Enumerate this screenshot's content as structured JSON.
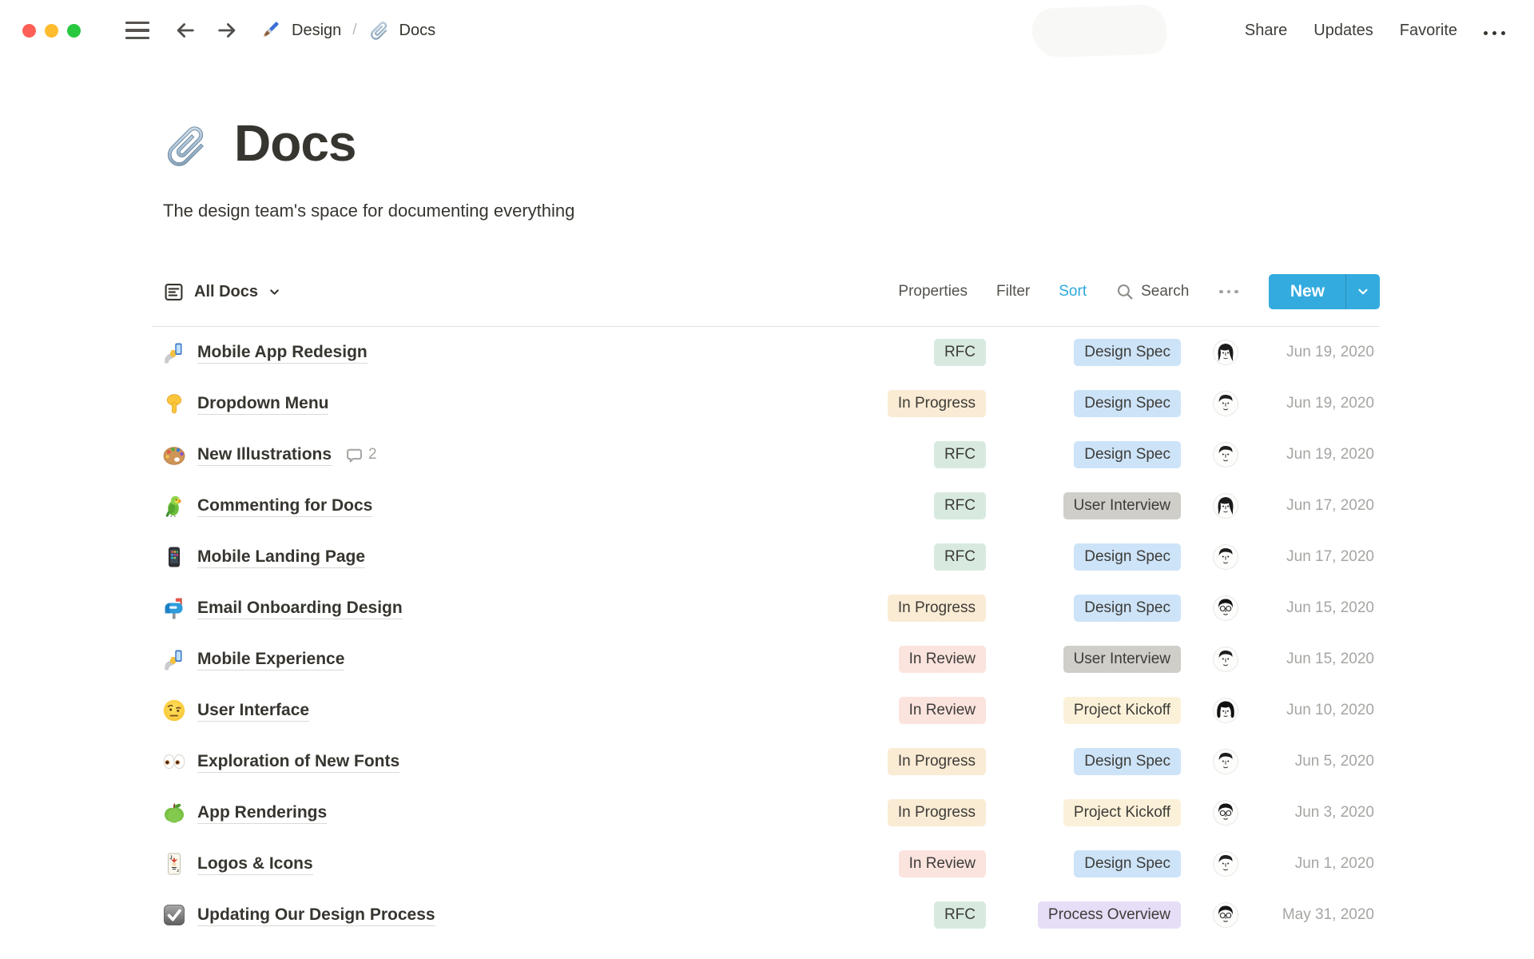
{
  "window": {
    "breadcrumb": [
      {
        "icon_name": "paintbrush-icon",
        "icon_ref": "#i-paintbrush",
        "label": "Design"
      },
      {
        "icon_name": "paperclip-icon",
        "icon_ref": "#i-paperclip",
        "label": "Docs"
      }
    ],
    "separator": "/",
    "actions": {
      "share": "Share",
      "updates": "Updates",
      "favorite": "Favorite"
    }
  },
  "page": {
    "icon_name": "paperclip-icon",
    "icon_ref": "#i-paperclip",
    "title": "Docs",
    "subtitle": "The design team's space for documenting everything"
  },
  "toolbar": {
    "view_label": "All Docs",
    "properties_label": "Properties",
    "filter_label": "Filter",
    "sort_label": "Sort",
    "search_label": "Search",
    "new_label": "New"
  },
  "colors": {
    "accent_blue": "#2EAADC",
    "badge_green": "#D8EAE0",
    "badge_blue": "#CDE3F8",
    "badge_orange": "#FAEBD4",
    "badge_yellow": "#FBF1D9",
    "badge_red": "#FBE3DE",
    "badge_gray": "#CFCEC9",
    "badge_purple": "#E6DDF7"
  },
  "table": {
    "rows": [
      {
        "icon_name": "selfie-icon",
        "icon": "#i-selfie",
        "title": "Mobile App Redesign",
        "status": "RFC",
        "status_bg": "#D8EAE0",
        "type": "Design Spec",
        "type_bg": "#CDE3F8",
        "avatar_name": "avatar-woman",
        "avatar": "#a-woman",
        "date": "Jun 19, 2020"
      },
      {
        "icon_name": "pointing-down-icon",
        "icon": "#i-pointdown",
        "title": "Dropdown Menu",
        "status": "In Progress",
        "status_bg": "#FAEBD4",
        "type": "Design Spec",
        "type_bg": "#CDE3F8",
        "avatar_name": "avatar-man",
        "avatar": "#a-man",
        "date": "Jun 19, 2020"
      },
      {
        "icon_name": "palette-icon",
        "icon": "#i-palette",
        "title": "New Illustrations",
        "comments": "2",
        "status": "RFC",
        "status_bg": "#D8EAE0",
        "type": "Design Spec",
        "type_bg": "#CDE3F8",
        "avatar_name": "avatar-man",
        "avatar": "#a-man",
        "date": "Jun 19, 2020"
      },
      {
        "icon_name": "parrot-icon",
        "icon": "#i-parrot",
        "title": "Commenting for Docs",
        "status": "RFC",
        "status_bg": "#D8EAE0",
        "type": "User Interview",
        "type_bg": "#CFCEC9",
        "avatar_name": "avatar-woman",
        "avatar": "#a-woman",
        "date": "Jun 17, 2020"
      },
      {
        "icon_name": "mobile-phone-icon",
        "icon": "#i-mobile",
        "title": "Mobile Landing Page",
        "status": "RFC",
        "status_bg": "#D8EAE0",
        "type": "Design Spec",
        "type_bg": "#CDE3F8",
        "avatar_name": "avatar-man",
        "avatar": "#a-man",
        "date": "Jun 17, 2020"
      },
      {
        "icon_name": "mailbox-icon",
        "icon": "#i-mailbox",
        "title": "Email Onboarding Design",
        "status": "In Progress",
        "status_bg": "#FAEBD4",
        "type": "Design Spec",
        "type_bg": "#CDE3F8",
        "avatar_name": "avatar-man-glasses",
        "avatar": "#a-manglasses",
        "date": "Jun 15, 2020"
      },
      {
        "icon_name": "selfie-icon",
        "icon": "#i-selfie",
        "title": "Mobile Experience",
        "status": "In Review",
        "status_bg": "#FBE3DE",
        "type": "User Interview",
        "type_bg": "#CFCEC9",
        "avatar_name": "avatar-man",
        "avatar": "#a-man",
        "date": "Jun 15, 2020"
      },
      {
        "icon_name": "raised-eyebrow-face-icon",
        "icon": "#i-eyebrow",
        "title": "User Interface",
        "status": "In Review",
        "status_bg": "#FBE3DE",
        "type": "Project Kickoff",
        "type_bg": "#FBF1D9",
        "avatar_name": "avatar-woman-curly",
        "avatar": "#a-womancurly",
        "date": "Jun 10, 2020"
      },
      {
        "icon_name": "eyes-icon",
        "icon": "#i-eyes",
        "title": "Exploration of New Fonts",
        "status": "In Progress",
        "status_bg": "#FAEBD4",
        "type": "Design Spec",
        "type_bg": "#CDE3F8",
        "avatar_name": "avatar-man",
        "avatar": "#a-man",
        "date": "Jun 5, 2020"
      },
      {
        "icon_name": "green-apple-icon",
        "icon": "#i-apple",
        "title": "App Renderings",
        "status": "In Progress",
        "status_bg": "#FAEBD4",
        "type": "Project Kickoff",
        "type_bg": "#FBF1D9",
        "avatar_name": "avatar-man-glasses",
        "avatar": "#a-manglasses",
        "date": "Jun 3, 2020"
      },
      {
        "icon_name": "joker-card-icon",
        "icon": "#i-joker",
        "title": "Logos & Icons",
        "status": "In Review",
        "status_bg": "#FBE3DE",
        "type": "Design Spec",
        "type_bg": "#CDE3F8",
        "avatar_name": "avatar-man",
        "avatar": "#a-man",
        "date": "Jun 1, 2020"
      },
      {
        "icon_name": "check-box-icon",
        "icon": "#i-checkbox",
        "title": "Updating Our Design Process",
        "status": "RFC",
        "status_bg": "#D8EAE0",
        "type": "Process Overview",
        "type_bg": "#E6DDF7",
        "avatar_name": "avatar-man-glasses",
        "avatar": "#a-manglasses",
        "date": "May 31, 2020"
      }
    ]
  }
}
